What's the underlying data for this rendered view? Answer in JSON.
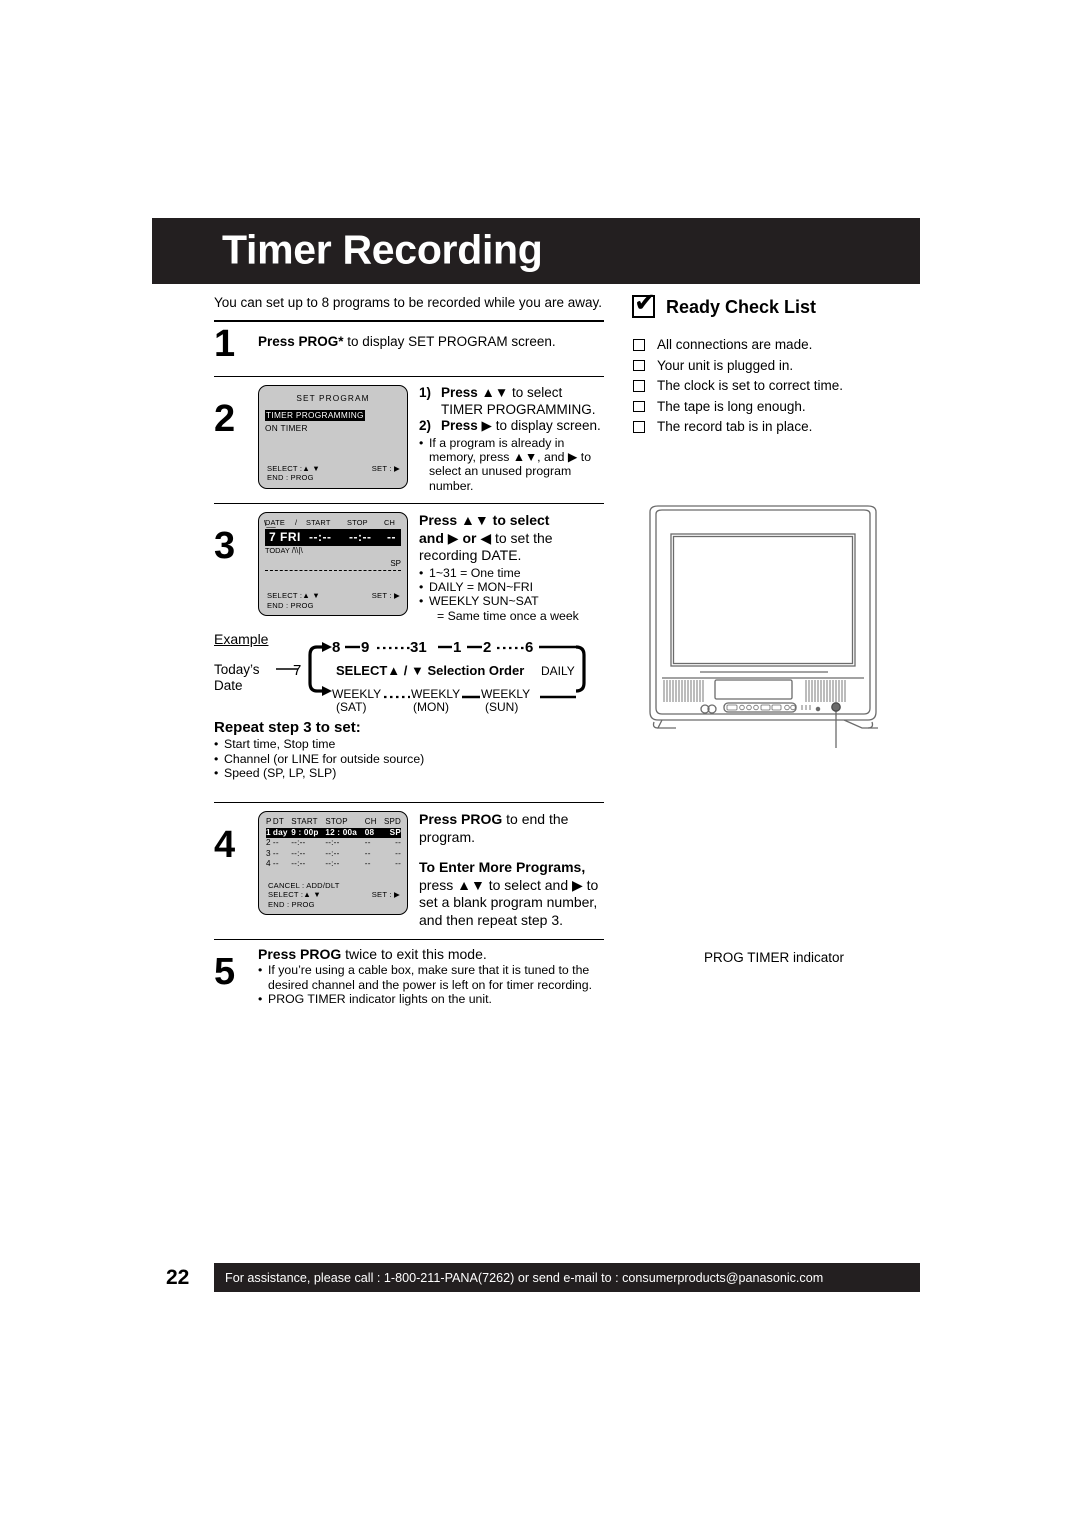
{
  "header": {
    "title": "Timer Recording"
  },
  "intro": "You can set up to 8 programs to be recorded while you are away.",
  "steps": {
    "s1": {
      "num": "1",
      "bold": "Press PROG*",
      "rest": " to display SET PROGRAM screen."
    },
    "s2": {
      "num": "2",
      "item1_mark": "1)",
      "item1_bold": "Press",
      "item1_rest": " to select TIMER PROGRAMMING.",
      "item2_mark": "2)",
      "item2_bold": "Press",
      "item2_rest": " to display screen.",
      "note": "If a program is already in memory, press ▲▼, and ▶ to select an unused program number.",
      "lcd": {
        "title": "SET  PROGRAM",
        "row_selected": "TIMER  PROGRAMMING",
        "row2": "ON TIMER",
        "foot_left1": "SELECT :▲ ▼",
        "foot_left2": "END      : PROG",
        "foot_right": "SET : ▶"
      }
    },
    "s3": {
      "num": "3",
      "head_bold1": "Press",
      "head_mid": "to select",
      "head_bold2": "and",
      "head_bold3": "or",
      "head_rest": "to set the",
      "head_line3": "recording DATE.",
      "bullets": [
        "1~31 = One time",
        "DAILY = MON~FRI",
        "WEEKLY SUN~SAT",
        "= Same time once a week"
      ],
      "lcd": {
        "hdr_date": "DATE",
        "hdr_slash": "/",
        "hdr_start": "START",
        "hdr_stop": "STOP",
        "hdr_ch": "CH",
        "big_day": "7 FRI",
        "big_start": "--:--",
        "big_stop": "--:--",
        "big_ch": "--",
        "today": "TODAY",
        "sp": "SP",
        "foot_left1": "SELECT :▲ ▼",
        "foot_left2": "END      : PROG",
        "foot_right": "SET : ▶"
      }
    },
    "s4": {
      "num": "4",
      "head_bold": "Press PROG",
      "head_rest": " to end the program.",
      "sub_bold": "To Enter More Programs,",
      "sub_rest": "press ▲▼ to select and ▶ to set a blank program number, and then repeat step 3.",
      "lcd": {
        "headers": [
          "P",
          "DT",
          "START",
          "STOP",
          "CH",
          "SPD"
        ],
        "rows": [
          {
            "p": "1",
            "dt": "day",
            "start": "9 : 00p",
            "stop": "12 : 00a",
            "ch": "08",
            "spd": "SP",
            "selected": true
          },
          {
            "p": "2",
            "dt": "--",
            "start": "--:--",
            "stop": "--:--",
            "ch": "--",
            "spd": "--",
            "selected": false
          },
          {
            "p": "3",
            "dt": "--",
            "start": "--:--",
            "stop": "--:--",
            "ch": "--",
            "spd": "--",
            "selected": false
          },
          {
            "p": "4",
            "dt": "--",
            "start": "--:--",
            "stop": "--:--",
            "ch": "--",
            "spd": "--",
            "selected": false
          }
        ],
        "foot_cancel": "CANCEL : ADD/DLT",
        "foot_left1": "SELECT :▲ ▼",
        "foot_left2": "END      : PROG",
        "foot_right": "SET : ▶"
      }
    },
    "s5": {
      "num": "5",
      "head_bold": "Press PROG",
      "head_rest": " twice to exit this mode.",
      "bullets": [
        "If you’re using a cable box, make sure that it is tuned to the desired channel and the power is left on for timer recording.",
        "PROG TIMER indicator lights on the unit."
      ]
    }
  },
  "example": {
    "label": "Example",
    "today_label_1": "Today’s",
    "today_label_2": "Date",
    "today_value": "7",
    "top_sequence": [
      "8",
      "9",
      "31",
      "1",
      "2",
      "6"
    ],
    "mid_left": "SELECT▲ / ▼",
    "mid_right": "Selection Order",
    "daily": "DAILY",
    "weekly": [
      {
        "name": "WEEKLY",
        "day": "(SAT)"
      },
      {
        "name": "WEEKLY",
        "day": "(MON)"
      },
      {
        "name": "WEEKLY",
        "day": "(SUN)"
      }
    ]
  },
  "repeat": {
    "title": "Repeat step 3 to set:",
    "items": [
      "Start time, Stop time",
      "Channel (or LINE for outside source)",
      "Speed (SP, LP, SLP)"
    ]
  },
  "ready_check": {
    "title": "Ready Check List",
    "items": [
      "All connections are made.",
      "Your unit is plugged in.",
      "The clock is set to correct time.",
      "The tape is long enough.",
      "The record tab is in place."
    ]
  },
  "tv": {
    "caption": "PROG TIMER indicator"
  },
  "footer": {
    "page_number": "22",
    "text": "For assistance, please call : 1-800-211-PANA(7262) or send e-mail to : consumerproducts@panasonic.com"
  },
  "colors": {
    "ink": "#231f20",
    "lcd_bg": "#c9c9c9"
  }
}
